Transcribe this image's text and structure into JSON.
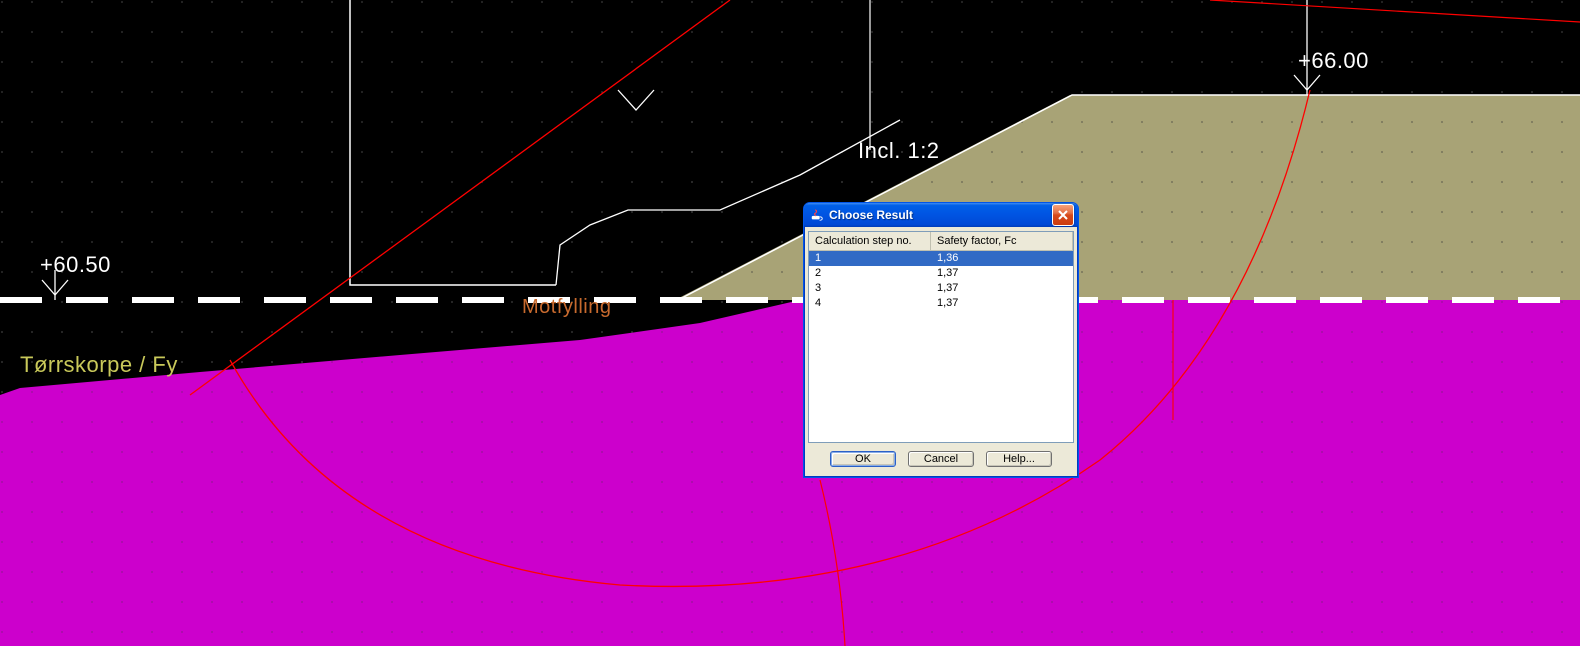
{
  "labels": {
    "elev_left": "+60.50",
    "elev_right": "+66.00",
    "incline": "Incl. 1:2",
    "bottom_layer": "Tørrskorpe / Fy",
    "fill_layer": "Motfylling"
  },
  "dialog": {
    "title": "Choose Result",
    "columns": {
      "c1": "Calculation step no.",
      "c2": "Safety factor, Fc"
    },
    "rows": [
      {
        "step": "1",
        "fc": "1,36",
        "selected": true
      },
      {
        "step": "2",
        "fc": "1,37",
        "selected": false
      },
      {
        "step": "3",
        "fc": "1,37",
        "selected": false
      },
      {
        "step": "4",
        "fc": "1,37",
        "selected": false
      }
    ],
    "buttons": {
      "ok": "OK",
      "cancel": "Cancel",
      "help": "Help..."
    }
  },
  "colors": {
    "soil": "#cc00cc",
    "fill": "#a8a376",
    "bg": "#000000",
    "grid_dot": "#303030",
    "line_red": "#ff0000",
    "line_white": "#ffffff",
    "label_yellow": "#c9c95a",
    "label_orange": "#c86a2e"
  }
}
